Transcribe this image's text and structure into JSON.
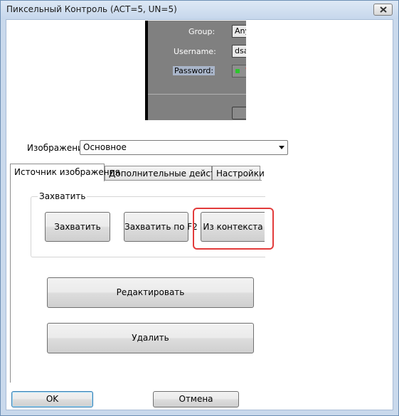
{
  "window": {
    "title": "Пиксельный Контроль (ACT=5, UN=5)"
  },
  "preview": {
    "group_label": "Group:",
    "group_value": "Any",
    "username_label": "Username:",
    "username_value": "dsa",
    "password_label": "Password:"
  },
  "image": {
    "label": "Изображение",
    "selected": "Основное"
  },
  "tabs": [
    {
      "label": "Источник изображения"
    },
    {
      "label": "Дополнительные действия"
    },
    {
      "label": "Настройки"
    }
  ],
  "capture_group": {
    "title": "Захватить",
    "capture_label": "Захватить",
    "capture_f2_label": "Захватить по F2",
    "from_context_label": "Из контекста"
  },
  "actions": {
    "edit_label": "Редактировать",
    "delete_label": "Удалить"
  },
  "footer": {
    "ok_label": "OK",
    "cancel_label": "Отмена"
  },
  "colors": {
    "highlight": "#e23b3b",
    "arrow": "#e04848",
    "status_dot": "#2cc52c"
  }
}
